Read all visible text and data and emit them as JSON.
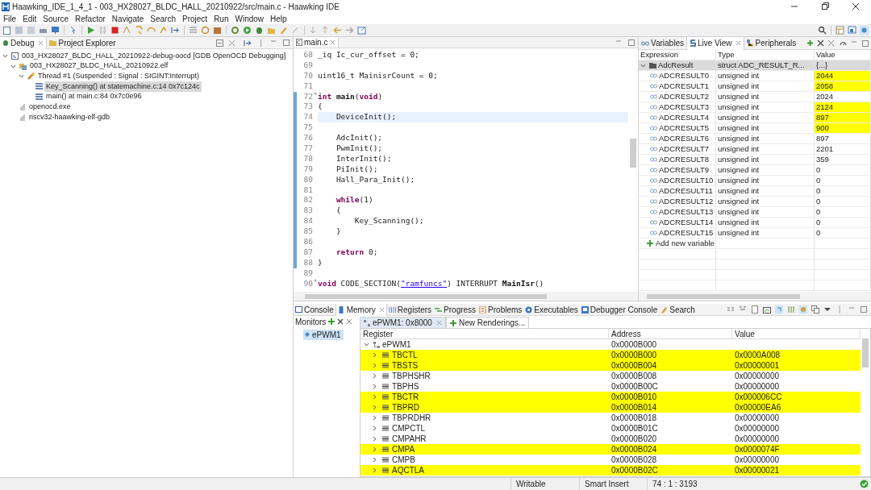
{
  "window": {
    "title": "Haawking_IDE_1_4_1 - 003_HX28027_BLDC_HALL_20210922/src/main.c - Haawking IDE"
  },
  "menu": [
    "File",
    "Edit",
    "Source",
    "Refactor",
    "Navigate",
    "Search",
    "Project",
    "Run",
    "Window",
    "Help"
  ],
  "debug_panel": {
    "tabs": [
      {
        "label": "Debug",
        "selected": true
      },
      {
        "label": "Project Explorer",
        "selected": false
      }
    ],
    "tree": [
      {
        "kind": "launch",
        "label": "003_HX28027_BLDC_HALL_20210922-debug-oocd [GDB OpenOCD Debugging]",
        "selected": false,
        "expanded": true,
        "children": [
          {
            "kind": "program",
            "label": "003_HX28027_BLDC_HALL_20210922.elf",
            "selected": false,
            "expanded": true,
            "children": [
              {
                "kind": "thread",
                "label": "Thread #1 (Suspended : Signal : SIGINT:Interrupt)",
                "selected": false,
                "expanded": true,
                "children": [
                  {
                    "kind": "frame",
                    "label": "Key_Scanning() at statemachine.c:14 0x7c124c",
                    "selected": true
                  },
                  {
                    "kind": "frame",
                    "label": "main() at main.c:84 0x7c0e96",
                    "selected": false
                  }
                ]
              }
            ]
          },
          {
            "kind": "process",
            "label": "openocd.exe",
            "selected": false
          },
          {
            "kind": "process",
            "label": "riscv32-haawking-elf-gdb",
            "selected": false
          }
        ]
      }
    ]
  },
  "editor": {
    "tab": "main.c",
    "lines": [
      {
        "number": "68",
        "marked": false,
        "current": false,
        "fold": false,
        "segments": [
          {
            "kind": "plain",
            "text": "_iq Ic_cur_offset = 0;"
          }
        ]
      },
      {
        "number": "69",
        "marked": false,
        "current": false,
        "fold": false
      },
      {
        "number": "70",
        "marked": false,
        "current": false,
        "fold": false,
        "segments": [
          {
            "kind": "plain",
            "text": "uint16_t MainisrCount = 0;"
          }
        ]
      },
      {
        "number": "71",
        "marked": false,
        "current": false,
        "fold": false
      },
      {
        "number": "72",
        "marked": true,
        "current": false,
        "fold": true,
        "segments": [
          {
            "kind": "keyword",
            "text": "int"
          },
          {
            "kind": "bold",
            "text": " main"
          },
          {
            "kind": "plain",
            "text": "("
          },
          {
            "kind": "keyword",
            "text": "void"
          },
          {
            "kind": "plain",
            "text": ")"
          }
        ]
      },
      {
        "number": "73",
        "marked": true,
        "current": false,
        "fold": false,
        "segments": [
          {
            "kind": "plain",
            "text": "{"
          }
        ]
      },
      {
        "number": "74",
        "marked": true,
        "current": true,
        "fold": false,
        "segments": [
          {
            "kind": "plain",
            "text": "    DeviceInit();"
          }
        ]
      },
      {
        "number": "75",
        "marked": true,
        "current": false,
        "fold": false
      },
      {
        "number": "76",
        "marked": true,
        "current": false,
        "fold": false,
        "segments": [
          {
            "kind": "plain",
            "text": "    AdcInit();"
          }
        ]
      },
      {
        "number": "77",
        "marked": true,
        "current": false,
        "fold": false,
        "segments": [
          {
            "kind": "plain",
            "text": "    PwmInit();"
          }
        ]
      },
      {
        "number": "78",
        "marked": true,
        "current": false,
        "fold": false,
        "segments": [
          {
            "kind": "plain",
            "text": "    InterInit();"
          }
        ]
      },
      {
        "number": "79",
        "marked": true,
        "current": false,
        "fold": false,
        "segments": [
          {
            "kind": "plain",
            "text": "    PiInit();"
          }
        ]
      },
      {
        "number": "80",
        "marked": true,
        "current": false,
        "fold": false,
        "segments": [
          {
            "kind": "plain",
            "text": "    Hall_Para_Init();"
          }
        ]
      },
      {
        "number": "81",
        "marked": true,
        "current": false,
        "fold": false
      },
      {
        "number": "82",
        "marked": true,
        "current": false,
        "fold": false,
        "segments": [
          {
            "kind": "keyword",
            "text": "    while"
          },
          {
            "kind": "plain",
            "text": "(1)"
          }
        ]
      },
      {
        "number": "83",
        "marked": true,
        "current": false,
        "fold": false,
        "segments": [
          {
            "kind": "plain",
            "text": "    {"
          }
        ]
      },
      {
        "number": "84",
        "marked": true,
        "current": false,
        "fold": false,
        "segments": [
          {
            "kind": "plain",
            "text": "        Key_Scanning();"
          }
        ]
      },
      {
        "number": "85",
        "marked": true,
        "current": false,
        "fold": false,
        "segments": [
          {
            "kind": "plain",
            "text": "    }"
          }
        ]
      },
      {
        "number": "86",
        "marked": true,
        "current": false,
        "fold": false
      },
      {
        "number": "87",
        "marked": true,
        "current": false,
        "fold": false,
        "segments": [
          {
            "kind": "keyword",
            "text": "    return"
          },
          {
            "kind": "plain",
            "text": " 0;"
          }
        ]
      },
      {
        "number": "88",
        "marked": true,
        "current": false,
        "fold": false,
        "segments": [
          {
            "kind": "plain",
            "text": "}"
          }
        ]
      },
      {
        "number": "89",
        "marked": false,
        "current": false,
        "fold": false
      },
      {
        "number": "90",
        "marked": false,
        "current": false,
        "fold": true,
        "segments": [
          {
            "kind": "keyword",
            "text": "void"
          },
          {
            "kind": "plain",
            "text": " CODE_SECTION("
          },
          {
            "kind": "string",
            "text": "\"ramfuncs\""
          },
          {
            "kind": "plain",
            "text": ") INTERRUPT "
          },
          {
            "kind": "bold",
            "text": "MainIsr"
          },
          {
            "kind": "plain",
            "text": "()"
          }
        ]
      }
    ]
  },
  "variables_panel": {
    "tabs": [
      {
        "label": "Variables",
        "selected": false
      },
      {
        "label": "Live View",
        "selected": true
      },
      {
        "label": "Peripherals",
        "selected": false
      }
    ],
    "columns": [
      "Expression",
      "Type",
      "Value"
    ],
    "root": {
      "expression": "AdcResult",
      "type": "struct ADC_RESULT_R...",
      "value": "{...}",
      "expanded": true
    },
    "rows": [
      {
        "expression": "ADCRESULT0",
        "type": "unsigned int",
        "value": "2044",
        "changed": true
      },
      {
        "expression": "ADCRESULT1",
        "type": "unsigned int",
        "value": "2058",
        "changed": true
      },
      {
        "expression": "ADCRESULT2",
        "type": "unsigned int",
        "value": "2024",
        "changed": false
      },
      {
        "expression": "ADCRESULT3",
        "type": "unsigned int",
        "value": "2124",
        "changed": true
      },
      {
        "expression": "ADCRESULT4",
        "type": "unsigned int",
        "value": "897",
        "changed": true
      },
      {
        "expression": "ADCRESULT5",
        "type": "unsigned int",
        "value": "900",
        "changed": true
      },
      {
        "expression": "ADCRESULT6",
        "type": "unsigned int",
        "value": "897",
        "changed": false
      },
      {
        "expression": "ADCRESULT7",
        "type": "unsigned int",
        "value": "2201",
        "changed": false
      },
      {
        "expression": "ADCRESULT8",
        "type": "unsigned int",
        "value": "359",
        "changed": false
      },
      {
        "expression": "ADCRESULT9",
        "type": "unsigned int",
        "value": "0",
        "changed": false
      },
      {
        "expression": "ADCRESULT10",
        "type": "unsigned int",
        "value": "0",
        "changed": false
      },
      {
        "expression": "ADCRESULT11",
        "type": "unsigned int",
        "value": "0",
        "changed": false
      },
      {
        "expression": "ADCRESULT12",
        "type": "unsigned int",
        "value": "0",
        "changed": false
      },
      {
        "expression": "ADCRESULT13",
        "type": "unsigned int",
        "value": "0",
        "changed": false
      },
      {
        "expression": "ADCRESULT14",
        "type": "unsigned int",
        "value": "0",
        "changed": false
      },
      {
        "expression": "ADCRESULT15",
        "type": "unsigned int",
        "value": "0",
        "changed": false
      }
    ],
    "add_label": "Add new variable"
  },
  "bottom_panel": {
    "tabs": [
      {
        "label": "Console",
        "selected": false
      },
      {
        "label": "Memory",
        "selected": true
      },
      {
        "label": "Registers",
        "selected": false
      },
      {
        "label": "Progress",
        "selected": false
      },
      {
        "label": "Problems",
        "selected": false
      },
      {
        "label": "Executables",
        "selected": false
      },
      {
        "label": "Debugger Console",
        "selected": false
      },
      {
        "label": "Search",
        "selected": false
      }
    ],
    "monitors": {
      "label": "Monitors",
      "items": [
        {
          "label": "ePWM1",
          "selected": true
        }
      ]
    },
    "renderings": [
      {
        "label": "ePWM1: 0x8000",
        "selected": true
      },
      {
        "label": "New Renderings...",
        "selected": false
      }
    ],
    "columns": [
      "Register",
      "Address",
      "Value"
    ],
    "group": {
      "name": "ePWM1",
      "address": "0x0000B000",
      "expanded": true
    },
    "rows": [
      {
        "name": "TBCTL",
        "address": "0x0000B000",
        "value": "0x0000A008",
        "changed": true
      },
      {
        "name": "TBSTS",
        "address": "0x0000B004",
        "value": "0x00000001",
        "changed": true
      },
      {
        "name": "TBPHSHR",
        "address": "0x0000B008",
        "value": "0x00000000",
        "changed": false
      },
      {
        "name": "TBPHS",
        "address": "0x0000B00C",
        "value": "0x00000000",
        "changed": false
      },
      {
        "name": "TBCTR",
        "address": "0x0000B010",
        "value": "0x000006CC",
        "changed": true
      },
      {
        "name": "TBPRD",
        "address": "0x0000B014",
        "value": "0x00000EA6",
        "changed": true
      },
      {
        "name": "TBPRDHR",
        "address": "0x0000B018",
        "value": "0x00000000",
        "changed": false
      },
      {
        "name": "CMPCTL",
        "address": "0x0000B01C",
        "value": "0x00000000",
        "changed": false
      },
      {
        "name": "CMPAHR",
        "address": "0x0000B020",
        "value": "0x00000000",
        "changed": false
      },
      {
        "name": "CMPA",
        "address": "0x0000B024",
        "value": "0x0000074F",
        "changed": true
      },
      {
        "name": "CMPB",
        "address": "0x0000B028",
        "value": "0x00000000",
        "changed": false
      },
      {
        "name": "AQCTLA",
        "address": "0x0000B02C",
        "value": "0x00000021",
        "changed": true
      }
    ]
  },
  "status_bar": [
    "Writable",
    "Smart Insert",
    "74 : 1 : 3193"
  ]
}
